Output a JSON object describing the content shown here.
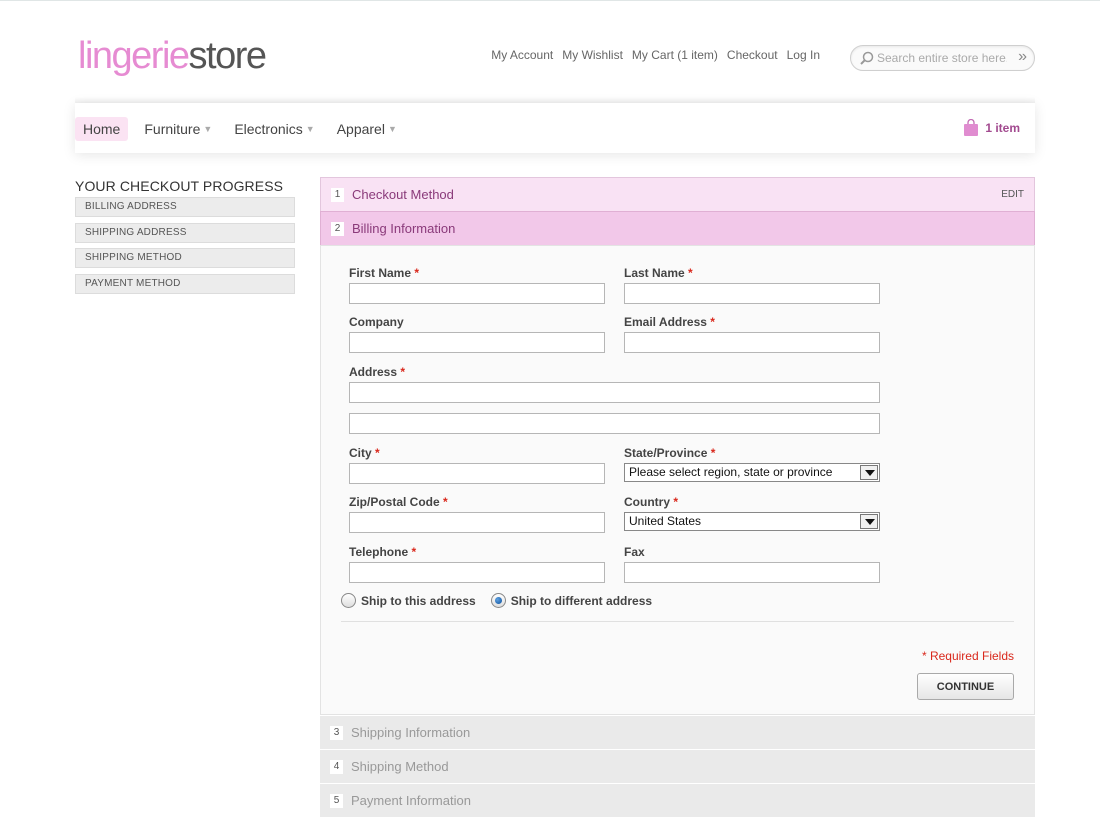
{
  "header": {
    "logo_part1": "lingerie",
    "logo_part2": "store",
    "links": [
      "My Account",
      "My Wishlist",
      "My Cart (1 item)",
      "Checkout",
      "Log In"
    ],
    "search_placeholder": "Search entire store here...",
    "search_go_icon": "double-chevron-right-icon"
  },
  "nav": {
    "items": [
      "Home",
      "Furniture",
      "Electronics",
      "Apparel"
    ],
    "cart_count": "1 item"
  },
  "sidebar": {
    "title": "YOUR CHECKOUT PROGRESS",
    "items": [
      "BILLING ADDRESS",
      "SHIPPING ADDRESS",
      "SHIPPING METHOD",
      "PAYMENT METHOD"
    ]
  },
  "steps": {
    "s1": {
      "num": "1",
      "title": "Checkout Method",
      "edit": "EDIT"
    },
    "s2": {
      "num": "2",
      "title": "Billing Information"
    },
    "s3": {
      "num": "3",
      "title": "Shipping Information"
    },
    "s4": {
      "num": "4",
      "title": "Shipping Method"
    },
    "s5": {
      "num": "5",
      "title": "Payment Information"
    }
  },
  "form": {
    "first_name": "First Name",
    "last_name": "Last Name",
    "company": "Company",
    "email": "Email Address",
    "address": "Address",
    "city": "City",
    "state": "State/Province",
    "state_value": "Please select region, state or province",
    "zip": "Zip/Postal Code",
    "country": "Country",
    "country_value": "United States",
    "telephone": "Telephone",
    "fax": "Fax",
    "required_mark": "*",
    "ship_this": "Ship to this address",
    "ship_different": "Ship to different address",
    "required_note": "* Required Fields",
    "continue": "CONTINUE"
  },
  "colors": {
    "brand_pink": "#e68bd2",
    "step_active": "#f2c8e9",
    "accent_text": "#8a3a7a",
    "required_red": "#d9281c"
  }
}
